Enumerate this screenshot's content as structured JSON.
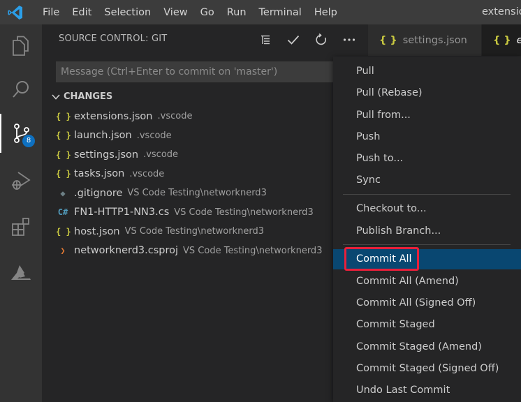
{
  "titlebar": {
    "menu": [
      "File",
      "Edit",
      "Selection",
      "View",
      "Go",
      "Run",
      "Terminal",
      "Help"
    ],
    "window_title": "extensio"
  },
  "activitybar": {
    "items": [
      {
        "icon": "files-icon"
      },
      {
        "icon": "search-icon"
      },
      {
        "icon": "source-control-icon",
        "badge": "8"
      },
      {
        "icon": "run-debug-icon"
      },
      {
        "icon": "extensions-icon"
      },
      {
        "icon": "azure-icon"
      }
    ]
  },
  "sidebar": {
    "header": "SOURCE CONTROL: GIT",
    "commit_placeholder": "Message (Ctrl+Enter to commit on 'master')",
    "changes_label": "CHANGES",
    "files": [
      {
        "icon": "{ }",
        "icon_color": "#cbcb41",
        "name": "extensions.json",
        "desc": ".vscode"
      },
      {
        "icon": "{ }",
        "icon_color": "#cbcb41",
        "name": "launch.json",
        "desc": ".vscode"
      },
      {
        "icon": "{ }",
        "icon_color": "#cbcb41",
        "name": "settings.json",
        "desc": ".vscode"
      },
      {
        "icon": "{ }",
        "icon_color": "#cbcb41",
        "name": "tasks.json",
        "desc": ".vscode"
      },
      {
        "icon": "◆",
        "icon_color": "#6d8086",
        "name": ".gitignore",
        "desc": "VS Code Testing\\networknerd3"
      },
      {
        "icon": "C#",
        "icon_color": "#519aba",
        "name": "FN1-HTTP1-NN3.cs",
        "desc": "VS Code Testing\\networknerd3"
      },
      {
        "icon": "{ }",
        "icon_color": "#cbcb41",
        "name": "host.json",
        "desc": "VS Code Testing\\networknerd3"
      },
      {
        "icon": "❯",
        "icon_color": "#e37933",
        "name": "networknerd3.csproj",
        "desc": "VS Code Testing\\networknerd3"
      }
    ]
  },
  "tabs": [
    {
      "label": "settings.json"
    },
    {
      "label": "ex"
    }
  ],
  "context_menu": {
    "groups": [
      [
        "Pull",
        "Pull (Rebase)",
        "Pull from...",
        "Push",
        "Push to...",
        "Sync"
      ],
      [
        "Checkout to...",
        "Publish Branch..."
      ],
      [
        "Commit All",
        "Commit All (Amend)",
        "Commit All (Signed Off)",
        "Commit Staged",
        "Commit Staged (Amend)",
        "Commit Staged (Signed Off)",
        "Undo Last Commit"
      ]
    ],
    "selected": "Commit All"
  },
  "colors": {
    "accent": "#0e70c0",
    "selection": "#094771",
    "highlight_box": "#e8203a"
  }
}
